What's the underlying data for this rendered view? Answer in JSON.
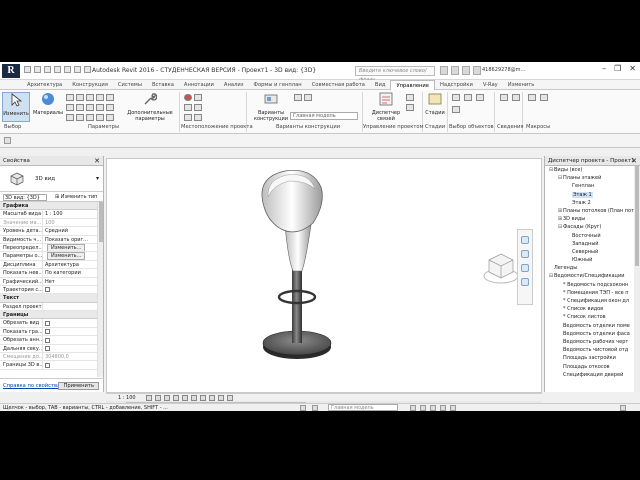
{
  "app": {
    "title": "Autodesk Revit 2016 - СТУДЕНЧЕСКАЯ ВЕРСИЯ -   Проект1 - 3D вид: {3D}",
    "search_placeholder": "Введите ключевое слово/фразу",
    "user": "418629278@m...",
    "accent": "#3a6ea5"
  },
  "tabs": [
    "Архитектура",
    "Конструкция",
    "Системы",
    "Вставка",
    "Аннотации",
    "Анализ",
    "Формы и генплан",
    "Совместная работа",
    "Вид",
    "Управление",
    "Надстройки",
    "V-Ray",
    "Изменить"
  ],
  "active_tab": "Управление",
  "ribbon": {
    "modify_label": "Изменить",
    "materials_label": "Материалы",
    "extra_params_label": "Дополнительные параметры",
    "design_options_label": "Варианты конструкции",
    "main_model": "Главная модель",
    "project_manager_label": "Диспетчер связей",
    "stages_label": "Стадии",
    "panels": {
      "select": "Выбор",
      "params": "Параметры",
      "location": "Местоположение проекта",
      "design_options": "Варианты конструкции",
      "project_mgmt": "Управление проектом",
      "stages": "Стадии",
      "object_select": "Выбор объектов",
      "info": "Сведения",
      "macros": "Макросы"
    }
  },
  "properties": {
    "title": "Свойства",
    "type_name": "3D вид",
    "instance": "3D вид: {3D}",
    "edit_type": "Изменить тип",
    "rows": [
      {
        "k": "Графика",
        "v": "",
        "section": true
      },
      {
        "k": "Масштаб вида",
        "v": "1 : 100"
      },
      {
        "k": "Значение ма...",
        "v": "100",
        "grey": true
      },
      {
        "k": "Уровень дета...",
        "v": "Средний"
      },
      {
        "k": "Видимость ч...",
        "v": "Показать ориг..."
      },
      {
        "k": "Переопредел...",
        "v": "Изменить...",
        "button": true
      },
      {
        "k": "Параметры о...",
        "v": "Изменить...",
        "button": true
      },
      {
        "k": "Дисциплина",
        "v": "Архитектура"
      },
      {
        "k": "Показать нев...",
        "v": "По категории"
      },
      {
        "k": "Графический...",
        "v": "Нет"
      },
      {
        "k": "Траектория с...",
        "v": "",
        "check": true
      },
      {
        "k": "Текст",
        "v": "",
        "section": true
      },
      {
        "k": "Раздел проекта",
        "v": ""
      },
      {
        "k": "Границы",
        "v": "",
        "section": true
      },
      {
        "k": "Обрезать вид",
        "v": "",
        "check": true
      },
      {
        "k": "Показать гра...",
        "v": "",
        "check": true
      },
      {
        "k": "Обрезать анн...",
        "v": "",
        "check": true
      },
      {
        "k": "Дальняя секу...",
        "v": "",
        "check": true
      },
      {
        "k": "Смещение до...",
        "v": "304800,0",
        "grey": true
      },
      {
        "k": "Границы 3D в...",
        "v": "",
        "check": true
      }
    ],
    "help_link": "Справка по свойствам",
    "apply": "Применить"
  },
  "browser": {
    "title": "Диспетчер проекта - Проект1",
    "nodes": [
      {
        "d": 0,
        "t": "−",
        "l": "Виды (все)"
      },
      {
        "d": 1,
        "t": "−",
        "l": "Планы этажей"
      },
      {
        "d": 2,
        "t": "",
        "l": "Генплан"
      },
      {
        "d": 2,
        "t": "",
        "l": "Этаж 1",
        "sel": true
      },
      {
        "d": 2,
        "t": "",
        "l": "Этаж 2"
      },
      {
        "d": 1,
        "t": "+",
        "l": "Планы потолков (План пот"
      },
      {
        "d": 1,
        "t": "+",
        "l": "3D виды"
      },
      {
        "d": 1,
        "t": "−",
        "l": "Фасады (Круг)"
      },
      {
        "d": 2,
        "t": "",
        "l": "Восточный"
      },
      {
        "d": 2,
        "t": "",
        "l": "Западный"
      },
      {
        "d": 2,
        "t": "",
        "l": "Северный"
      },
      {
        "d": 2,
        "t": "",
        "l": "Южный"
      },
      {
        "d": 0,
        "t": "",
        "l": "Легенды"
      },
      {
        "d": 0,
        "t": "−",
        "l": "Ведомости/Спецификации"
      },
      {
        "d": 1,
        "t": "",
        "l": "* Ведомость подсхоконн"
      },
      {
        "d": 1,
        "t": "",
        "l": "* Помещения ТЭП - все п"
      },
      {
        "d": 1,
        "t": "",
        "l": "* Спецификация окон дл"
      },
      {
        "d": 1,
        "t": "",
        "l": "* Список видов"
      },
      {
        "d": 1,
        "t": "",
        "l": "* Список листов"
      },
      {
        "d": 1,
        "t": "",
        "l": "Ведомость отделки поме"
      },
      {
        "d": 1,
        "t": "",
        "l": "Ведомость отделки фаса"
      },
      {
        "d": 1,
        "t": "",
        "l": "Ведомость рабочих черт"
      },
      {
        "d": 1,
        "t": "",
        "l": "Ведомость чистовой отд"
      },
      {
        "d": 1,
        "t": "",
        "l": "Площадь застройки"
      },
      {
        "d": 1,
        "t": "",
        "l": "Площадь откосов"
      },
      {
        "d": 1,
        "t": "",
        "l": "Спецификация дверей"
      }
    ]
  },
  "viewport": {
    "scale": "1 : 100"
  },
  "statusbar": {
    "message": "Щелчок - выбор, TAB - варианты, CTRL - добавление, SHIFT - ...",
    "model": "Главная модель"
  }
}
